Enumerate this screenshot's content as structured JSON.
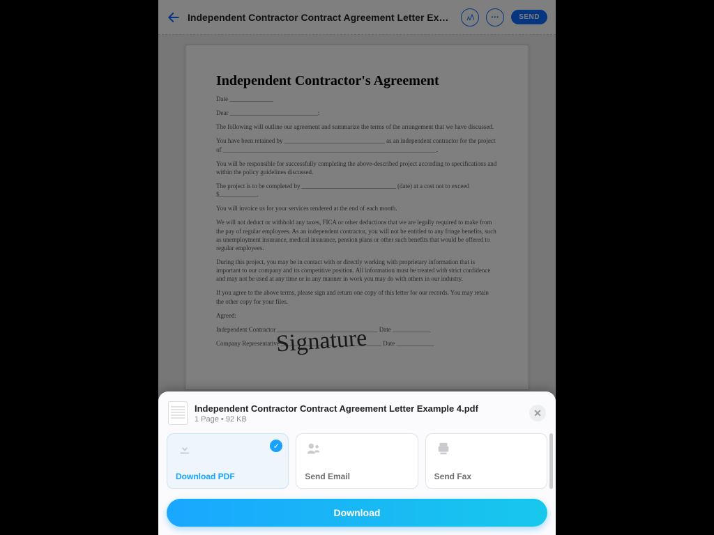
{
  "topbar": {
    "title": "Independent Contractor Contract Agreement Letter Example 4",
    "send_label": "SEND"
  },
  "document": {
    "heading": "Independent Contractor's Agreement",
    "p_date": "Date ______________",
    "p_dear": "Dear ____________________________:",
    "p_intro": "The following will outline our agreement and summarize the terms of the arrangement that we have discussed.",
    "p_retained": "You have been retained by ________________________________ as an independent contractor for the project of ____________________________________________________________________.",
    "p_responsible": "You will be responsible for successfully completing the above-described project according to specifications and within the policy guidelines discussed.",
    "p_completion": "The project is to be completed by ______________________________ (date) at a cost not to exceed $____________.",
    "p_invoice": "You will invoice us for your services rendered at the end of each month.",
    "p_deduct": "We will not deduct or withhold any taxes, FICA or other deductions that we are legally required to make from the pay of regular employees. As an independent contractor, you will not be entitled to any fringe benefits, such as unemployment insurance, medical insurance, pension plans or other such benefits that would be offered to regular employees.",
    "p_confidential": "During this project, you may be in contact with or directly working with proprietary information that is important to our company and its competitive position. All information must be treated with strict confidence and may not be used at any time or in any manner in work you may do with others in our industry.",
    "p_agree": "If you agree to the above terms, please sign and return one copy of this letter for our records. You may retain the other copy for your files.",
    "p_agreed": "Agreed:",
    "p_sig1": "Independent Contractor ________________________________  Date ____________",
    "p_sig2": "Company Representative ________________________________  Date ____________",
    "signature_text": "Signature"
  },
  "sheet": {
    "file_name": "Independent Contractor Contract Agreement Letter Example 4.pdf",
    "meta": "1 Page • 92 KB",
    "cards": {
      "download_pdf": "Download PDF",
      "send_email": "Send Email",
      "send_fax": "Send Fax"
    },
    "button": "Download"
  }
}
